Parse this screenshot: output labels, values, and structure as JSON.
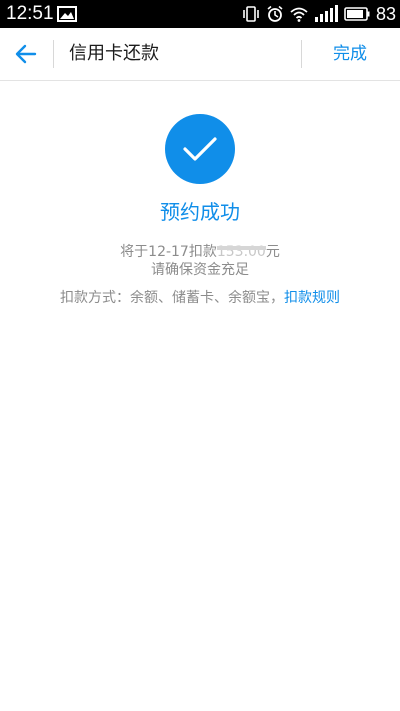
{
  "status_bar": {
    "time": "12:51",
    "battery_level": "83",
    "icons": [
      "gallery-icon",
      "vibrate-icon",
      "alarm-icon",
      "wifi-icon",
      "signal-icon",
      "battery-icon"
    ]
  },
  "header": {
    "back_icon": "arrow-left-icon",
    "title": "信用卡还款",
    "done_label": "完成"
  },
  "result": {
    "icon": "checkmark-icon",
    "title": "预约成功",
    "line1_prefix": "将于12-17扣款",
    "amount_masked": "153.00",
    "line1_suffix": "元",
    "line2": "请确保资金充足",
    "method_text": "扣款方式：余额、储蓄卡、余额宝，",
    "rules_link": "扣款规则"
  },
  "colors": {
    "accent": "#108ee9",
    "muted_text": "#8c8c8c",
    "title_text": "#1c1c1c"
  }
}
